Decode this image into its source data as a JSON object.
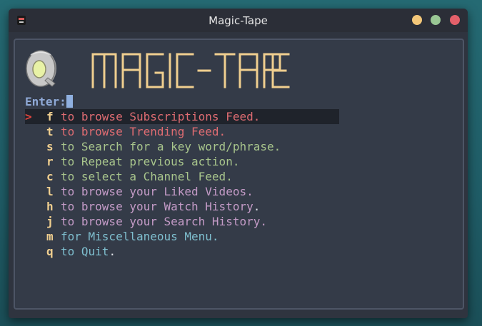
{
  "window": {
    "title": "Magic-Tape"
  },
  "logo": {
    "text": "MAGIC-TAPE"
  },
  "prompt": {
    "label": "Enter:"
  },
  "menu": {
    "selected_marker": ">",
    "items": [
      {
        "key": "f",
        "text": "to browse Subscriptions Feed.",
        "color": "#df6c72",
        "selected": true
      },
      {
        "key": "t",
        "text": "to browse Trending Feed.",
        "color": "#df6c72",
        "selected": false
      },
      {
        "key": "s",
        "text": "to Search for a key word/phrase.",
        "color": "#a8c58c",
        "selected": false
      },
      {
        "key": "r",
        "text": "to Repeat previous action.",
        "color": "#a8c58c",
        "selected": false
      },
      {
        "key": "c",
        "text": "to select a Channel Feed.",
        "color": "#a8c58c",
        "selected": false
      },
      {
        "key": "l",
        "text": "to browse your Liked Videos.",
        "color": "#c49bc7",
        "selected": false
      },
      {
        "key": "h",
        "text": "to browse your Watch History",
        "suffix": ".",
        "color": "#c49bc7",
        "selected": false
      },
      {
        "key": "j",
        "text": "to browse your Search History.",
        "color": "#c49bc7",
        "selected": false
      },
      {
        "key": "m",
        "text": "for Miscellaneous Menu.",
        "color": "#7fbfcf",
        "selected": false
      },
      {
        "key": "q",
        "text": "to Quit",
        "suffix": ".",
        "color": "#7fbfcf",
        "selected": false
      }
    ]
  },
  "colors": {
    "accent_key": "#f0cf8f",
    "logo_text": "#f0cf8f",
    "marker": "#e0463f",
    "titlebar_buttons": [
      "#f3c779",
      "#99c794",
      "#e4606a"
    ]
  }
}
